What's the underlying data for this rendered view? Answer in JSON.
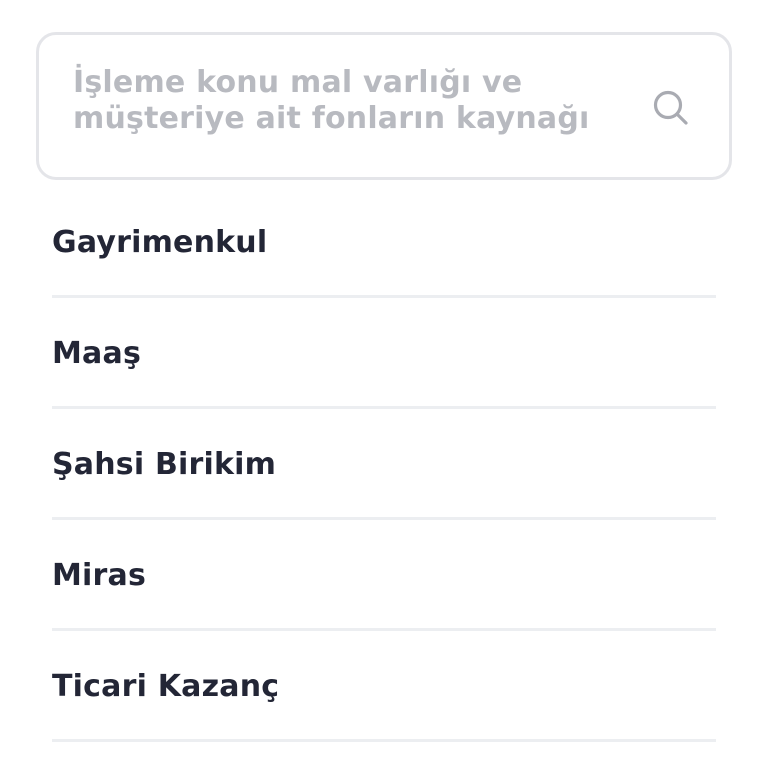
{
  "search": {
    "placeholder_line1": "İşleme konu mal varlığı ve",
    "placeholder_line2": "müşteriye ait fonların kaynağı",
    "icon": "search-icon"
  },
  "options": [
    {
      "label": "Gayrimenkul"
    },
    {
      "label": "Maaş"
    },
    {
      "label": "Şahsi Birikim"
    },
    {
      "label": "Miras"
    },
    {
      "label": "Ticari Kazanç"
    }
  ],
  "colors": {
    "text": "#232636",
    "placeholder": "#b8bac0",
    "border": "#e4e5e9",
    "divider": "#eceef1",
    "icon": "#a9abb2"
  }
}
